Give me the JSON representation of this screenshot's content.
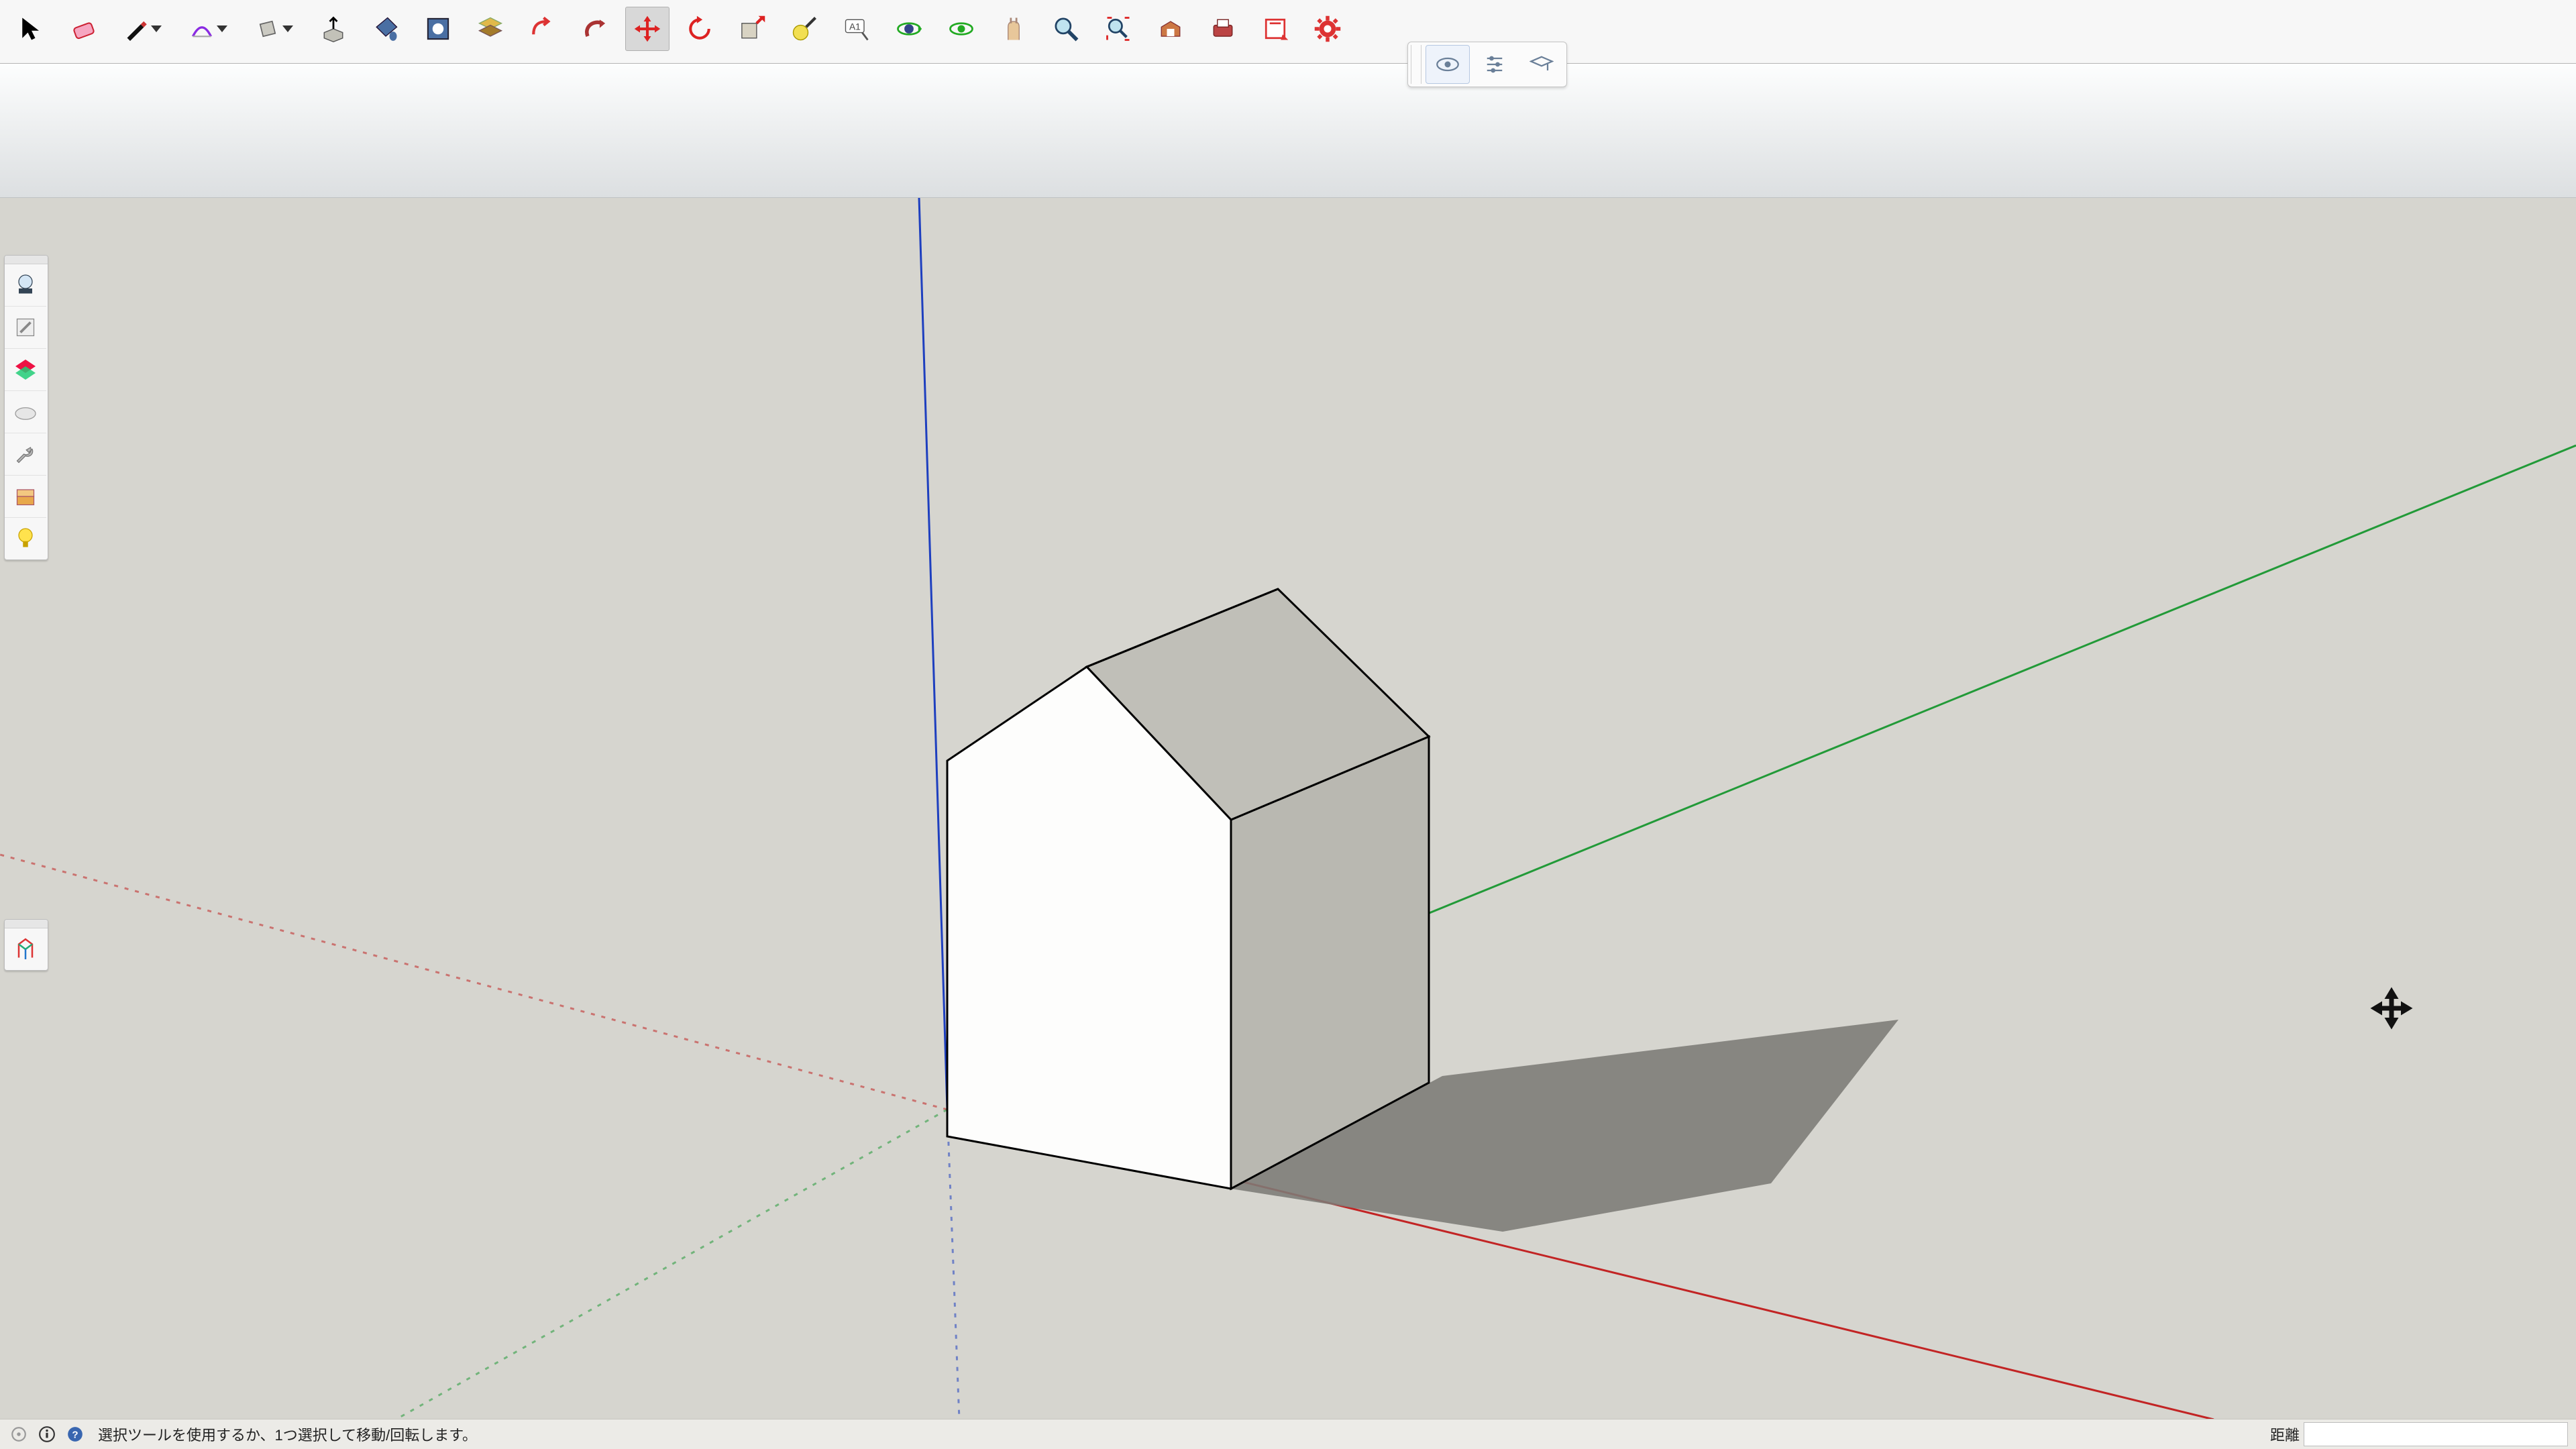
{
  "app": {
    "status_hint": "選択ツールを使用するか、1つ選択して移動/回転します。",
    "measurement_label": "距離",
    "measurement_value": ""
  },
  "toolbar": {
    "tools": [
      {
        "id": "select-tool",
        "name": "select-arrow-icon",
        "active": false
      },
      {
        "id": "eraser-tool",
        "name": "eraser-icon",
        "active": false
      },
      {
        "id": "line-tool",
        "name": "pencil-icon",
        "active": false,
        "dropdown": true
      },
      {
        "id": "arc-tool",
        "name": "arc-icon",
        "active": false,
        "dropdown": true
      },
      {
        "id": "rectangle-tool",
        "name": "rectangle-icon",
        "active": false,
        "dropdown": true
      },
      {
        "id": "pushpull-tool",
        "name": "pushpull-icon",
        "active": false
      },
      {
        "id": "paint-tool",
        "name": "paint-bucket-icon",
        "active": false
      },
      {
        "id": "section-tool",
        "name": "section-plane-icon",
        "active": false
      },
      {
        "id": "pie-tool",
        "name": "layers-icon",
        "active": false
      },
      {
        "id": "offset-tool",
        "name": "offset-icon",
        "active": false
      },
      {
        "id": "followme-tool",
        "name": "followme-icon",
        "active": false
      },
      {
        "id": "move-tool",
        "name": "move-arrows-icon",
        "active": true
      },
      {
        "id": "rotate-tool",
        "name": "rotate-icon",
        "active": false
      },
      {
        "id": "scale-tool",
        "name": "scale-icon",
        "active": false
      },
      {
        "id": "tape-tool",
        "name": "tape-measure-icon",
        "active": false
      },
      {
        "id": "text-tool",
        "name": "text-label-icon",
        "active": false
      },
      {
        "id": "orbit-tool",
        "name": "orbit-icon",
        "active": false
      },
      {
        "id": "pan-tool",
        "name": "pan-hand-icon",
        "active": false
      },
      {
        "id": "walk-tool",
        "name": "walk-hand-icon",
        "active": false
      },
      {
        "id": "zoom-tool",
        "name": "magnifier-icon",
        "active": false
      },
      {
        "id": "zoom-extents-tool",
        "name": "zoom-extents-icon",
        "active": false
      },
      {
        "id": "warehouse-tool",
        "name": "warehouse-icon",
        "active": false
      },
      {
        "id": "print-tool",
        "name": "print-icon",
        "active": false
      },
      {
        "id": "export-tool",
        "name": "layout-icon",
        "active": false
      },
      {
        "id": "settings-tool",
        "name": "gear-ruby-icon",
        "active": false
      }
    ]
  },
  "left_tray_1": {
    "items": [
      {
        "id": "render-btn",
        "name": "render-icon"
      },
      {
        "id": "material-edit-btn",
        "name": "material-edit-icon"
      },
      {
        "id": "materials-btn",
        "name": "materials-swatch-icon"
      },
      {
        "id": "environment-btn",
        "name": "environment-cloud-icon"
      },
      {
        "id": "tool-settings-btn",
        "name": "wrench-icon"
      },
      {
        "id": "resources-btn",
        "name": "stack-icon"
      },
      {
        "id": "lighting-btn",
        "name": "lightbulb-icon"
      }
    ]
  },
  "left_tray_2": {
    "items": [
      {
        "id": "plugin-btn",
        "name": "plugin-icon"
      }
    ]
  },
  "float_bar": {
    "buttons": [
      {
        "id": "view-toggle-btn",
        "name": "eye-icon",
        "active": true
      },
      {
        "id": "settings-toggle-btn",
        "name": "sliders-icon",
        "active": false
      },
      {
        "id": "hat-toggle-btn",
        "name": "graduation-icon",
        "active": false
      }
    ]
  },
  "status_icons": [
    "bulb-off-icon",
    "info-icon",
    "help-icon"
  ],
  "scene": {
    "axes": {
      "x": "red",
      "y": "green",
      "z": "blue"
    },
    "object": "house-shaped-block",
    "shadow": true,
    "cursor": "move-cursor"
  }
}
